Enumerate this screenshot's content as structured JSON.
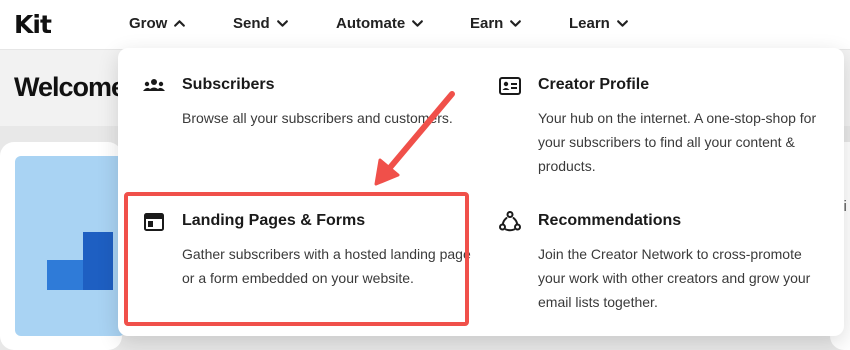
{
  "logo": "Kit",
  "nav": [
    {
      "label": "Grow",
      "expanded": true
    },
    {
      "label": "Send",
      "expanded": false
    },
    {
      "label": "Automate",
      "expanded": false
    },
    {
      "label": "Earn",
      "expanded": false
    },
    {
      "label": "Learn",
      "expanded": false
    }
  ],
  "page": {
    "welcome": "Welcome",
    "right_snippet": "vi"
  },
  "grow_menu": {
    "items": [
      {
        "icon": "users-icon",
        "title": "Subscribers",
        "description": "Browse all your subscribers and customers."
      },
      {
        "icon": "id-card-icon",
        "title": "Creator Profile",
        "description": "Your hub on the internet. A one-stop-shop for your subscribers to find all your content & products."
      },
      {
        "icon": "layout-window-icon",
        "title": "Landing Pages & Forms",
        "description": "Gather subscribers with a hosted landing page or a form embedded on your website."
      },
      {
        "icon": "network-icon",
        "title": "Recommendations",
        "description": "Join the Creator Network to cross-promote your work with other creators and grow your email lists together."
      }
    ]
  },
  "colors": {
    "annotation": "#f0504a",
    "illustration_bg": "#a9d3f3",
    "illustration_bar": "#2f7bd8"
  }
}
